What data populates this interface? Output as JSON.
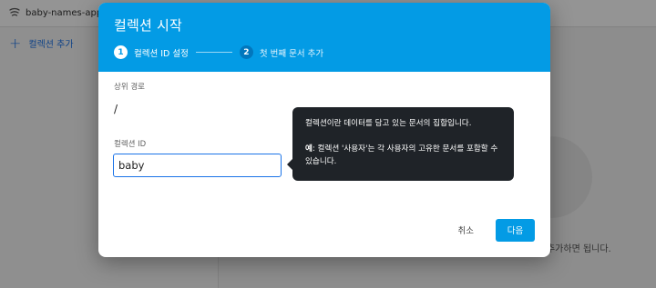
{
  "background": {
    "project_name": "baby-names-app-",
    "add_collection_label": "컬렉션 추가",
    "hint_text": "데이터만 추가하면 됩니다."
  },
  "dialog": {
    "title": "컬렉션 시작",
    "steps": [
      {
        "number": "1",
        "label": "컬렉션 ID 설정",
        "state": "active"
      },
      {
        "number": "2",
        "label": "첫 번째 문서 추가",
        "state": "inactive"
      }
    ],
    "parent_path_label": "상위 경로",
    "parent_path_value": "/",
    "collection_id_label": "컬렉션 ID",
    "collection_id_value": "baby",
    "cancel_label": "취소",
    "next_label": "다음"
  },
  "tooltip": {
    "line1": "컬렉션이란 데이터를 담고 있는 문서의 집합입니다.",
    "example_bold": "예",
    "example_text": ": 컬렉션 '사용자'는 각 사용자의 고유한 문서를 포함할 수 있습니다."
  },
  "colors": {
    "header_blue": "#039be5",
    "primary_button": "#039be5",
    "input_focus": "#1a73e8",
    "tooltip_bg": "#1f2328"
  },
  "icons": {
    "project": "firebase-database-icon",
    "add": "plus-icon"
  }
}
